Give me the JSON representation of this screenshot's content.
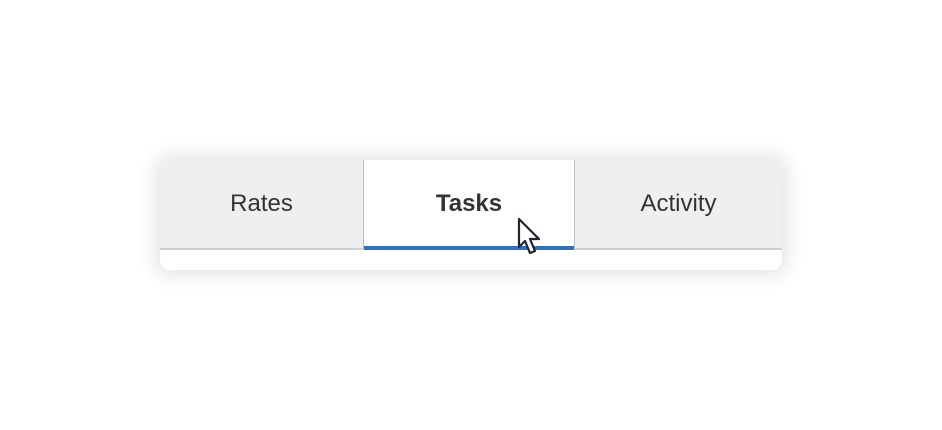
{
  "tabs": [
    {
      "label": "Rates",
      "selected": false
    },
    {
      "label": "Tasks",
      "selected": true
    },
    {
      "label": "Activity",
      "selected": false
    }
  ],
  "colors": {
    "active_indicator": "#2f6fc4",
    "inactive_tab_bg": "#efeff2",
    "active_tab_bg": "#ffffff",
    "text": "#333333"
  },
  "icons": {
    "cursor": "mouse-pointer-icon"
  }
}
